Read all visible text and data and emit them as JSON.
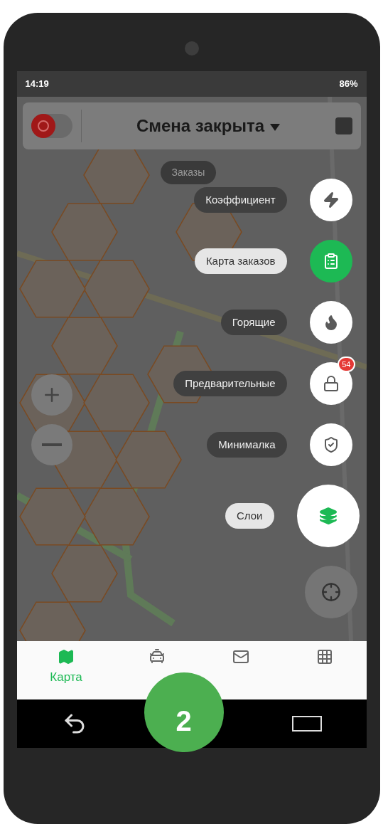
{
  "status_bar": {
    "time": "14:19",
    "battery": "86%"
  },
  "header": {
    "shift_on": false,
    "title": "Смена закрыта"
  },
  "chip": "Заказы",
  "actions": [
    {
      "label": "Коэффициент",
      "kind": "small",
      "selected": false
    },
    {
      "label": "Карта заказов",
      "kind": "small",
      "selected": true
    },
    {
      "label": "Горящие",
      "kind": "small",
      "selected": false
    },
    {
      "label": "Предварительные",
      "kind": "small",
      "selected": false,
      "badge": "54"
    },
    {
      "label": "Минималка",
      "kind": "small",
      "selected": false
    },
    {
      "label": "Слои",
      "kind": "main",
      "selected": false
    }
  ],
  "bottom_nav": [
    {
      "label": "Карта",
      "selected": true
    },
    {
      "selected": false
    },
    {
      "selected": false
    },
    {
      "selected": false
    }
  ],
  "step_marker": "2"
}
